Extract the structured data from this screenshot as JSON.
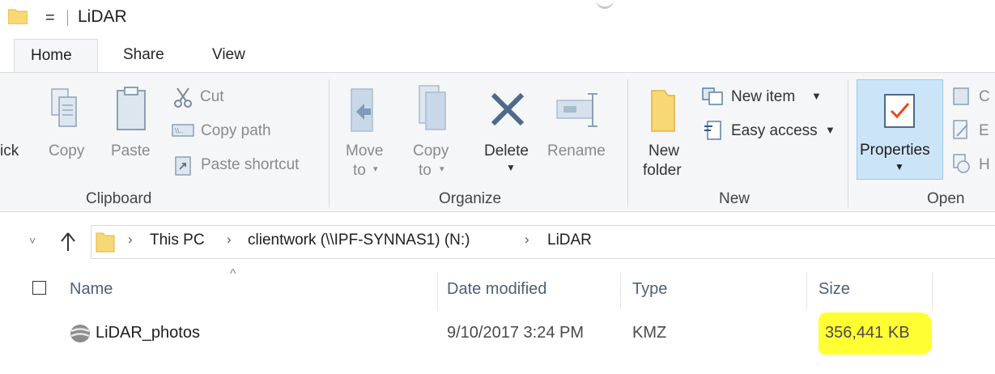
{
  "window": {
    "title": "LiDAR",
    "quick_access": "="
  },
  "tabs": [
    {
      "label": "Home"
    },
    {
      "label": "Share"
    },
    {
      "label": "View"
    }
  ],
  "ribbon": {
    "clipboard": {
      "name": "Clipboard",
      "quick": "ick",
      "copy": "Copy",
      "paste": "Paste",
      "cut": "Cut",
      "copy_path": "Copy path",
      "paste_shortcut": "Paste shortcut"
    },
    "organize": {
      "name": "Organize",
      "move_to": "Move",
      "move_to_2": "to",
      "copy_to": "Copy",
      "copy_to_2": "to",
      "delete": "Delete",
      "rename": "Rename"
    },
    "new": {
      "name": "New",
      "new_folder": "New",
      "new_folder_2": "folder",
      "new_item": "New item",
      "easy_access": "Easy access"
    },
    "open": {
      "name": "Open",
      "properties": "Properties",
      "clipped_1": "C",
      "clipped_2": "E",
      "clipped_3": "H"
    }
  },
  "address": {
    "crumbs": [
      "This PC",
      "clientwork (\\\\IPF-SYNNAS1) (N:)",
      "LiDAR"
    ]
  },
  "file_list": {
    "columns": [
      "Name",
      "Date modified",
      "Type",
      "Size"
    ],
    "rows": [
      {
        "name": "LiDAR_photos",
        "date_modified": "9/10/2017 3:24 PM",
        "type": "KMZ",
        "size": "356,441 KB"
      }
    ]
  },
  "colors": {
    "accent": "#0078d7",
    "folder": "#f8d775",
    "highlight": "#ffff33"
  }
}
